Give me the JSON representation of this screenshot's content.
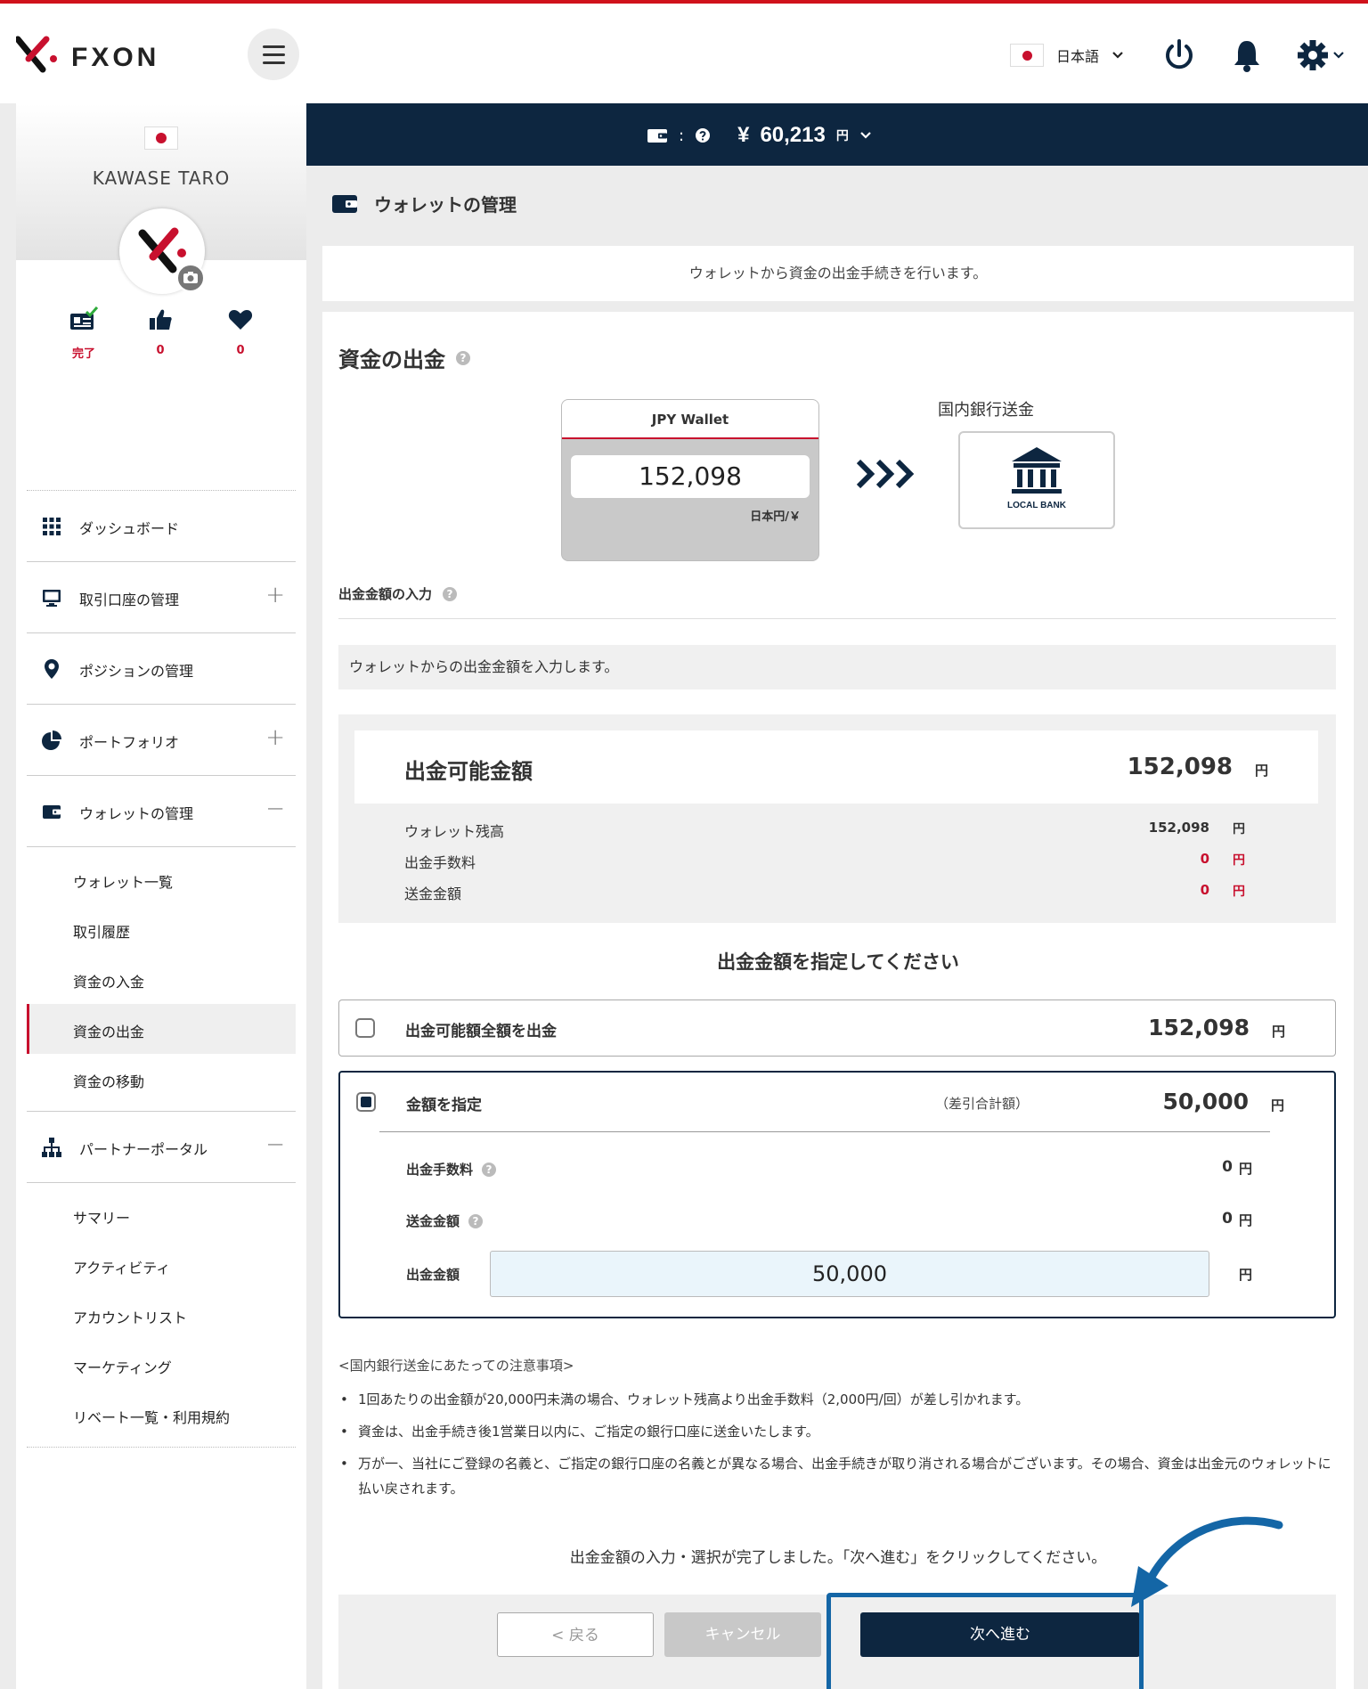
{
  "header": {
    "brand": "FXON",
    "language": "日本語",
    "colors": {
      "accent": "#c8102e",
      "navy": "#0d2640"
    }
  },
  "balance_bar": {
    "colon": ":",
    "currency_symbol": "¥",
    "amount": "60,213",
    "unit": "円"
  },
  "profile": {
    "name": "KAWASE TARO",
    "stats": [
      {
        "icon": "id-card-check-icon",
        "value": "完了"
      },
      {
        "icon": "thumbs-up-icon",
        "value": "0"
      },
      {
        "icon": "heart-icon",
        "value": "0"
      }
    ]
  },
  "nav": {
    "dashboard": "ダッシュボード",
    "accounts": "取引口座の管理",
    "positions": "ポジションの管理",
    "portfolio": "ポートフォリオ",
    "wallet": "ウォレットの管理",
    "wallet_sub": [
      "ウォレット一覧",
      "取引履歴",
      "資金の入金",
      "資金の出金",
      "資金の移動"
    ],
    "partner": "パートナーポータル",
    "partner_sub": [
      "サマリー",
      "アクティビティ",
      "アカウントリスト",
      "マーケティング",
      "リベート一覧・利用規約"
    ],
    "expand": "+",
    "collapse": "−"
  },
  "page": {
    "title": "ウォレットの管理",
    "intro": "ウォレットから資金の出金手続きを行います。"
  },
  "withdraw": {
    "title": "資金の出金",
    "wallet_name": "JPY Wallet",
    "wallet_balance": "152,098",
    "wallet_unit": "日本円/￥",
    "arrow": "❯❯❯",
    "destination_label": "国内銀行送金",
    "bank_icon_label": "LOCAL BANK",
    "input_section": "出金金額の入力",
    "input_note": "ウォレットからの出金金額を入力します。",
    "available_title": "出金可能金額",
    "available_value": "152,098",
    "unit": "円",
    "rows": [
      {
        "label": "ウォレット残高",
        "value": "152,098"
      },
      {
        "label": "出金手数料",
        "value": "0"
      },
      {
        "label": "送金金額",
        "value": "0"
      }
    ],
    "specify_title": "出金金額を指定してください",
    "option_all": {
      "label": "出金可能額全額を出金",
      "value": "152,098",
      "checked": false
    },
    "option_specify": {
      "label": "金額を指定",
      "note": "（差引合計額）",
      "value": "50,000",
      "checked": true,
      "fee_label": "出金手数料",
      "fee_value": "0",
      "transfer_label": "送金金額",
      "transfer_value": "0",
      "amount_label": "出金金額",
      "amount_input": "50,000"
    },
    "notes_head": "<国内銀行送金にあたっての注意事項>",
    "notes": [
      "1回あたりの出金額が20,000円未満の場合、ウォレット残高より出金手数料（2,000円/回）が差し引かれます。",
      "資金は、出金手続き後1営業日以内に、ご指定の銀行口座に送金いたします。",
      "万が一、当社にご登録の名義と、ご指定の銀行口座の名義とが異なる場合、出金手続きが取り消される場合がございます。その場合、資金は出金元のウォレットに払い戻されます。"
    ],
    "complete_msg": "出金金額の入力・選択が完了しました。「次へ進む」をクリックしてください。",
    "buttons": {
      "back": "< 戻る",
      "cancel": "キャンセル",
      "next": "次へ進む"
    }
  }
}
